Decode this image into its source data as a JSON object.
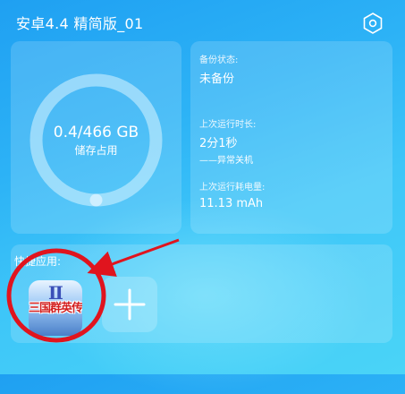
{
  "header": {
    "title": "安卓4.4 精简版_01",
    "settings_icon": "hexagon-settings-icon"
  },
  "storage": {
    "used_gb": 0.4,
    "total_gb": 466,
    "value_text": "0.4/466 GB",
    "label": "储存占用"
  },
  "status": {
    "backup_label": "备份状态:",
    "backup_value": "未备份",
    "runtime_label": "上次运行时长:",
    "runtime_value": "2分1秒",
    "runtime_note": "——异常关机",
    "power_label": "上次运行耗电量:",
    "power_value": "11.13 mAh"
  },
  "quick_apps": {
    "label": "快捷应用:",
    "apps": [
      {
        "name": "三国群英传",
        "roman": "Ⅱ",
        "icon": "app-game-icon"
      }
    ],
    "add_icon": "plus-icon"
  },
  "colors": {
    "background_top": "#1fa0f2",
    "background_bottom": "#4ad4f7",
    "ring_track": "#d9f4ff",
    "ring_progress": "#2b8fe6",
    "annotation": "#e0141e"
  }
}
